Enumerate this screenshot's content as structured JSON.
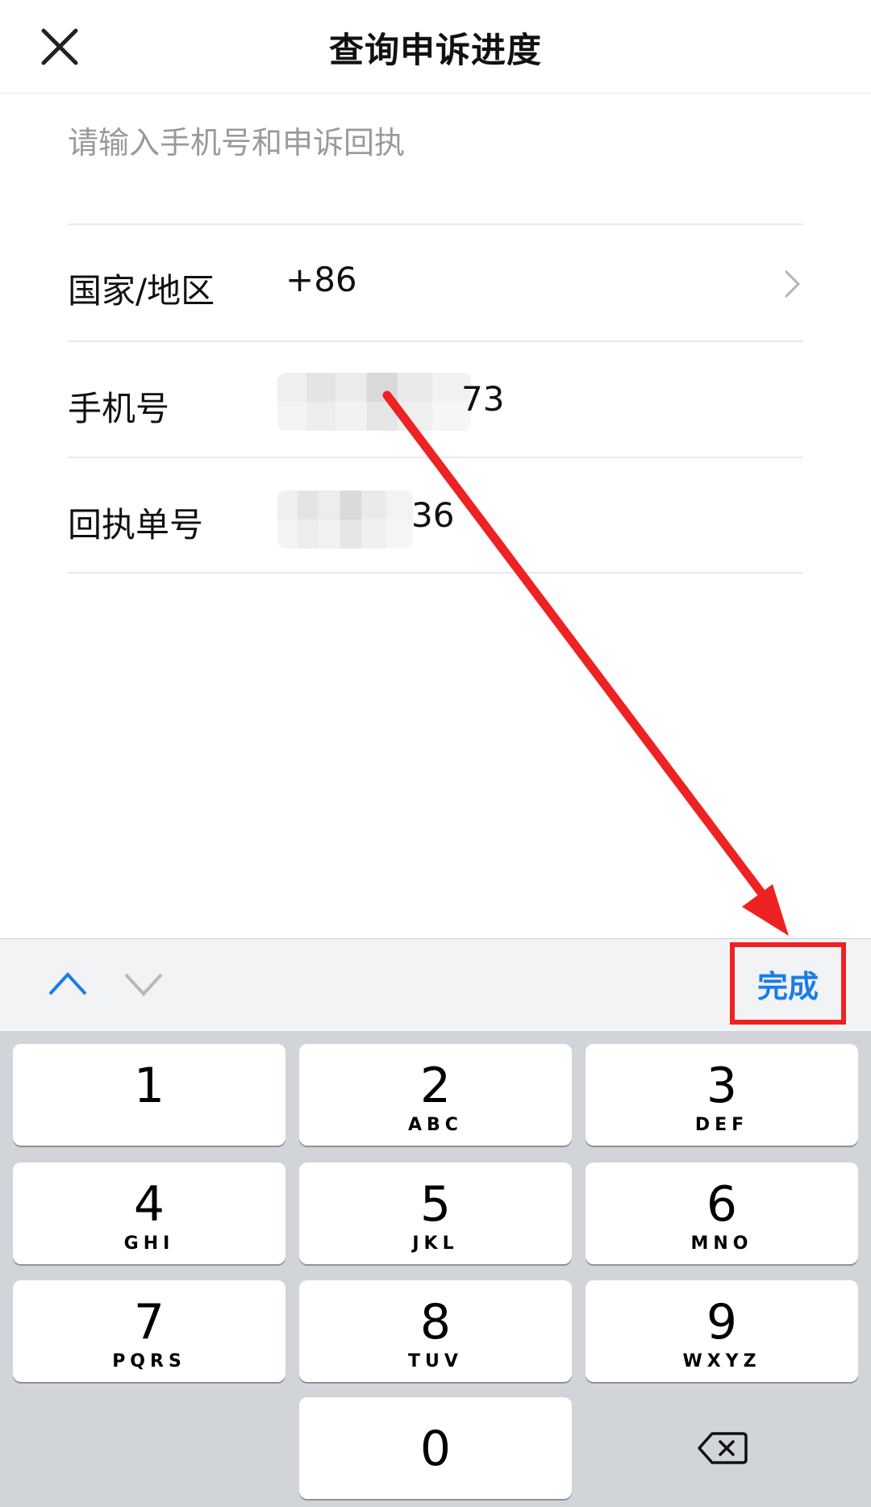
{
  "header": {
    "title": "查询申诉进度",
    "close_icon": "close-icon"
  },
  "form": {
    "hint": "请输入手机号和申诉回执",
    "country": {
      "label": "国家/地区",
      "value": "+86"
    },
    "phone": {
      "label": "手机号",
      "visible_suffix": "73"
    },
    "receipt": {
      "label": "回执单号",
      "visible_suffix": "36"
    }
  },
  "toolbar": {
    "done_label": "完成",
    "accent": "#1a7de6",
    "highlight": "#ee2222"
  },
  "keypad": {
    "k1": {
      "digit": "1",
      "letters": ""
    },
    "k2": {
      "digit": "2",
      "letters": "ABC"
    },
    "k3": {
      "digit": "3",
      "letters": "DEF"
    },
    "k4": {
      "digit": "4",
      "letters": "GHI"
    },
    "k5": {
      "digit": "5",
      "letters": "JKL"
    },
    "k6": {
      "digit": "6",
      "letters": "MNO"
    },
    "k7": {
      "digit": "7",
      "letters": "PQRS"
    },
    "k8": {
      "digit": "8",
      "letters": "TUV"
    },
    "k9": {
      "digit": "9",
      "letters": "WXYZ"
    },
    "k0": {
      "digit": "0",
      "letters": ""
    },
    "delete_icon": "backspace-icon"
  }
}
